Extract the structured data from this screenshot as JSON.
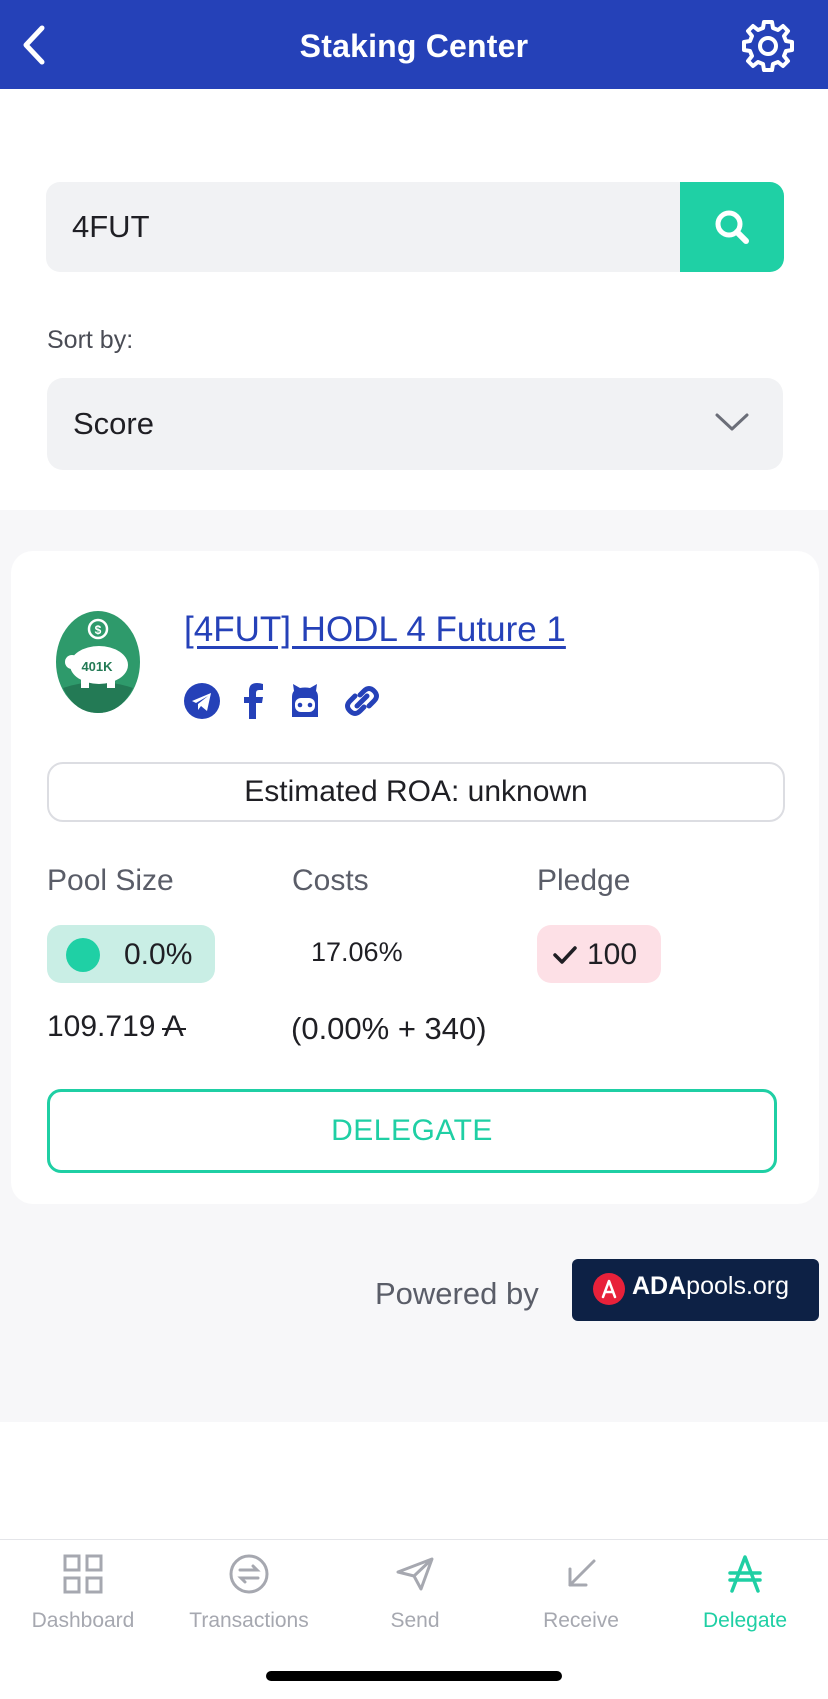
{
  "header": {
    "title": "Staking Center",
    "back_icon": "chevron-left-icon",
    "settings_icon": "gear-icon"
  },
  "search": {
    "value": "4FUT",
    "button_icon": "search-icon"
  },
  "sort": {
    "label": "Sort by:",
    "selected": "Score"
  },
  "pool": {
    "name": "[4FUT] HODL 4 Future 1",
    "logo_text": "401K",
    "social_icons": [
      "telegram-icon",
      "facebook-icon",
      "github-icon",
      "link-icon"
    ],
    "roa": "Estimated ROA: unknown",
    "columns": {
      "pool_size": "Pool Size",
      "costs": "Costs",
      "pledge": "Pledge"
    },
    "pool_size_pct": "0.0%",
    "pool_amount": "109.719",
    "ada_symbol": "A",
    "costs_pct": "17.06%",
    "costs_detail": "(0.00% + 340)",
    "pledge_value": "100",
    "delegate_label": "DELEGATE"
  },
  "footer": {
    "powered_by": "Powered by",
    "brand_bold": "ADA",
    "brand_rest": "pools.org"
  },
  "nav": {
    "items": [
      {
        "label": "Dashboard",
        "icon": "dashboard-icon"
      },
      {
        "label": "Transactions",
        "icon": "transactions-icon"
      },
      {
        "label": "Send",
        "icon": "send-icon"
      },
      {
        "label": "Receive",
        "icon": "receive-icon"
      },
      {
        "label": "Delegate",
        "icon": "ada-icon",
        "active": true
      }
    ]
  },
  "colors": {
    "header": "#2541b8",
    "accent": "#1fd0a5",
    "pledge_bg": "#fde0e6",
    "brand_bg": "#0d2145"
  }
}
